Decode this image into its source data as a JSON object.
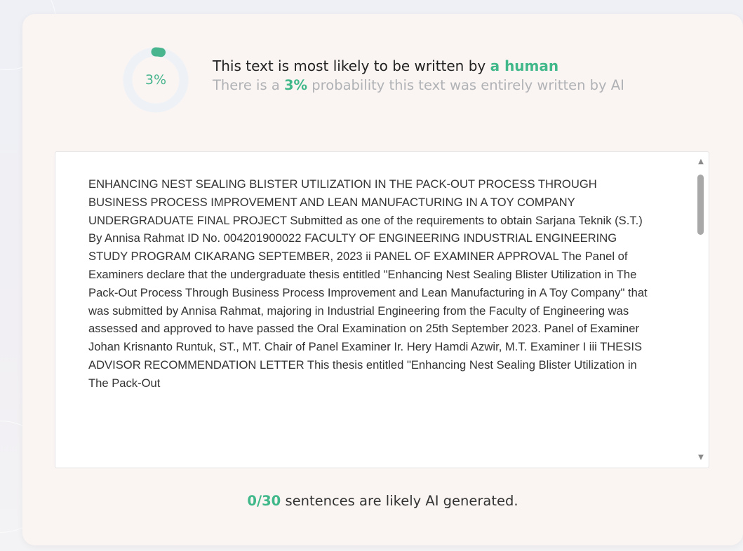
{
  "gauge": {
    "label": "3%",
    "value_fraction": 0.03,
    "track_color": "#eef2f7",
    "fill_color": "#48b58f"
  },
  "verdict": {
    "prefix": "This text is most likely to be written by ",
    "highlight": "a human"
  },
  "probability": {
    "prefix": "There is a ",
    "value": "3%",
    "suffix": " probability this text was entirely written by AI"
  },
  "document": {
    "text": "ENHANCING NEST SEALING BLISTER UTILIZATION IN THE PACK-OUT PROCESS THROUGH BUSINESS PROCESS IMPROVEMENT AND LEAN MANUFACTURING IN A TOY COMPANY UNDERGRADUATE FINAL PROJECT Submitted as one of the requirements to obtain Sarjana Teknik (S.T.) By Annisa Rahmat ID No. 004201900022 FACULTY OF ENGINEERING INDUSTRIAL ENGINEERING STUDY PROGRAM CIKARANG SEPTEMBER, 2023 ii PANEL OF EXAMINER APPROVAL The Panel of Examiners declare that the undergraduate thesis entitled \"Enhancing Nest Sealing Blister Utilization in The Pack-Out Process Through Business Process Improvement and Lean Manufacturing in A Toy Company\" that was submitted by Annisa Rahmat, majoring in Industrial Engineering from the Faculty of Engineering was assessed and approved to have passed the Oral Examination on 25th September 2023. Panel of Examiner Johan Krisnanto Runtuk, ST., MT. Chair of Panel Examiner Ir. Hery Hamdi Azwir, M.T. Examiner I iii THESIS ADVISOR RECOMMENDATION LETTER This thesis entitled \"Enhancing Nest Sealing Blister Utilization in The Pack-Out"
  },
  "summary": {
    "count": "0/30",
    "text": " sentences are likely AI generated."
  },
  "colors": {
    "accent": "#40b88a",
    "card_background": "#faf5f2"
  }
}
